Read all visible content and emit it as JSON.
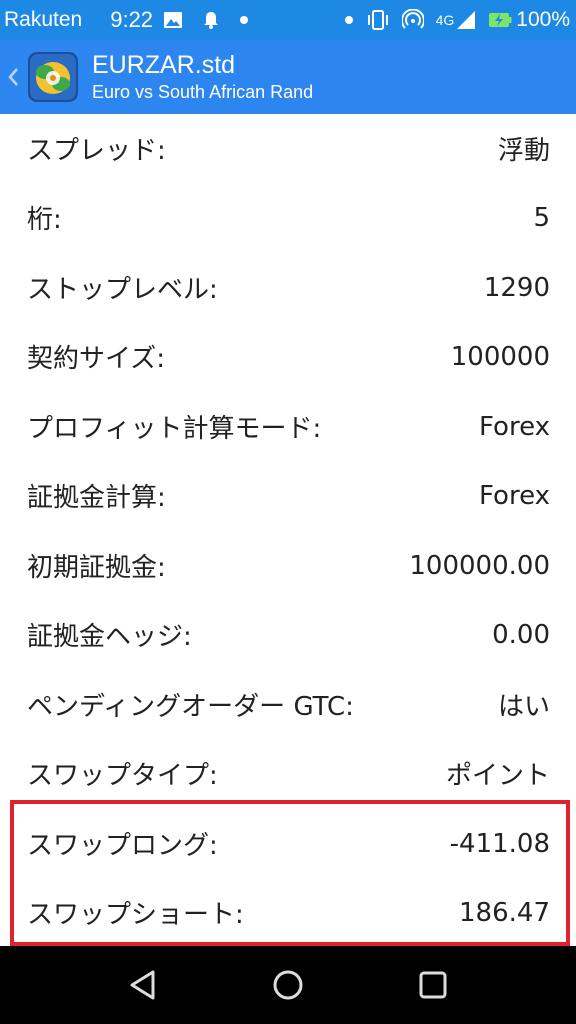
{
  "status_bar": {
    "carrier": "Rakuten",
    "time": "9:22",
    "network": "4G",
    "battery": "100%",
    "icons": [
      "image-icon",
      "notification-bell-icon",
      "dot-icon",
      "dot-icon",
      "vibrate-icon",
      "hotspot-icon",
      "signal-icon",
      "battery-charging-icon"
    ]
  },
  "app_bar": {
    "title": "EURZAR.std",
    "subtitle": "Euro vs South African Rand",
    "back_icon": "chevron-left-icon",
    "logo_icon": "metatrader-logo-icon",
    "color": "#2d86f0"
  },
  "rows": [
    {
      "label": "スプレッド:",
      "value": "浮動"
    },
    {
      "label": "桁:",
      "value": "5"
    },
    {
      "label": "ストップレベル:",
      "value": "1290"
    },
    {
      "label": "契約サイズ:",
      "value": "100000"
    },
    {
      "label": "プロフィット計算モード:",
      "value": "Forex"
    },
    {
      "label": "証拠金計算:",
      "value": "Forex"
    },
    {
      "label": "初期証拠金:",
      "value": "100000.00"
    },
    {
      "label": "証拠金ヘッジ:",
      "value": "0.00"
    },
    {
      "label": "ペンディングオーダー GTC:",
      "value": "はい"
    },
    {
      "label": "スワップタイプ:",
      "value": "ポイント"
    },
    {
      "label": "スワップロング:",
      "value": "-411.08"
    },
    {
      "label": "スワップショート:",
      "value": "186.47"
    }
  ],
  "highlight": {
    "color": "#e0212e"
  },
  "nav_bar": {
    "icons": [
      "back-triangle-icon",
      "home-circle-icon",
      "recents-square-icon"
    ]
  }
}
